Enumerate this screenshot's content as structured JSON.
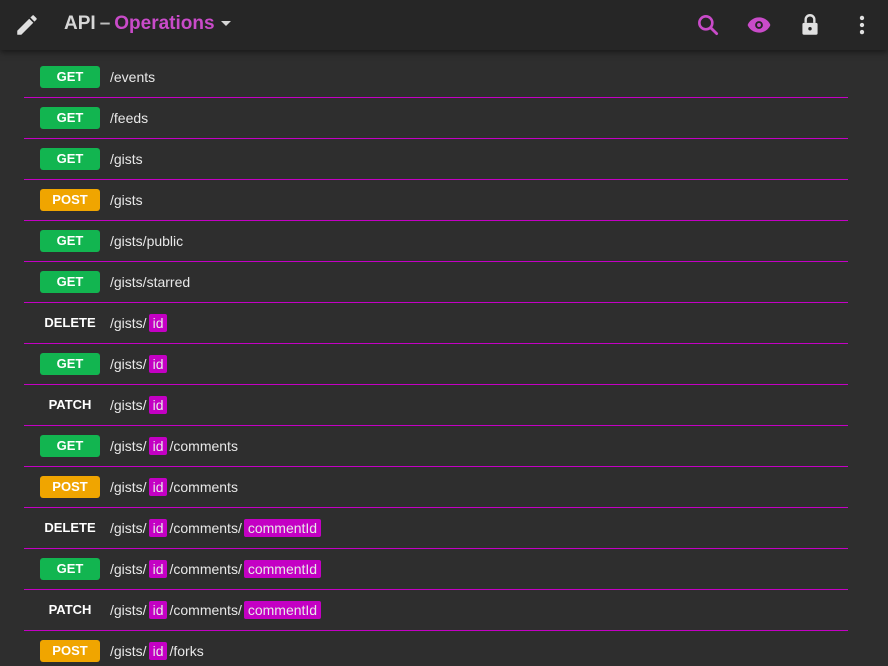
{
  "header": {
    "title": "API",
    "separator": "–",
    "subtitle": "Operations"
  },
  "rows": [
    {
      "method": "GET",
      "badge_class": "get",
      "segments": [
        {
          "t": "/events"
        }
      ]
    },
    {
      "method": "GET",
      "badge_class": "get",
      "segments": [
        {
          "t": "/feeds"
        }
      ]
    },
    {
      "method": "GET",
      "badge_class": "get",
      "segments": [
        {
          "t": "/gists"
        }
      ]
    },
    {
      "method": "POST",
      "badge_class": "post",
      "segments": [
        {
          "t": "/gists"
        }
      ]
    },
    {
      "method": "GET",
      "badge_class": "get",
      "segments": [
        {
          "t": "/gists/public"
        }
      ]
    },
    {
      "method": "GET",
      "badge_class": "get",
      "segments": [
        {
          "t": "/gists/starred"
        }
      ]
    },
    {
      "method": "DELETE",
      "badge_class": "delete",
      "segments": [
        {
          "t": "/gists/"
        },
        {
          "p": "id"
        }
      ]
    },
    {
      "method": "GET",
      "badge_class": "get",
      "segments": [
        {
          "t": "/gists/"
        },
        {
          "p": "id"
        }
      ]
    },
    {
      "method": "PATCH",
      "badge_class": "patch",
      "segments": [
        {
          "t": "/gists/"
        },
        {
          "p": "id"
        }
      ]
    },
    {
      "method": "GET",
      "badge_class": "get",
      "segments": [
        {
          "t": "/gists/"
        },
        {
          "p": "id"
        },
        {
          "t": "/comments"
        }
      ]
    },
    {
      "method": "POST",
      "badge_class": "post",
      "segments": [
        {
          "t": "/gists/"
        },
        {
          "p": "id"
        },
        {
          "t": "/comments"
        }
      ]
    },
    {
      "method": "DELETE",
      "badge_class": "delete",
      "segments": [
        {
          "t": "/gists/"
        },
        {
          "p": "id"
        },
        {
          "t": "/comments/"
        },
        {
          "p": "commentId"
        }
      ]
    },
    {
      "method": "GET",
      "badge_class": "get",
      "segments": [
        {
          "t": "/gists/"
        },
        {
          "p": "id"
        },
        {
          "t": "/comments/"
        },
        {
          "p": "commentId"
        }
      ]
    },
    {
      "method": "PATCH",
      "badge_class": "patch",
      "segments": [
        {
          "t": "/gists/"
        },
        {
          "p": "id"
        },
        {
          "t": "/comments/"
        },
        {
          "p": "commentId"
        }
      ]
    },
    {
      "method": "POST",
      "badge_class": "post",
      "segments": [
        {
          "t": "/gists/"
        },
        {
          "p": "id"
        },
        {
          "t": "/forks"
        }
      ]
    }
  ],
  "icons": {
    "edit": "pencil-icon",
    "search": "search-icon",
    "view": "eye-icon",
    "lock": "lock-icon",
    "more": "more-vert-icon"
  },
  "colors": {
    "get": "#12b550",
    "post": "#f0a500",
    "accent": "#c400c4"
  }
}
